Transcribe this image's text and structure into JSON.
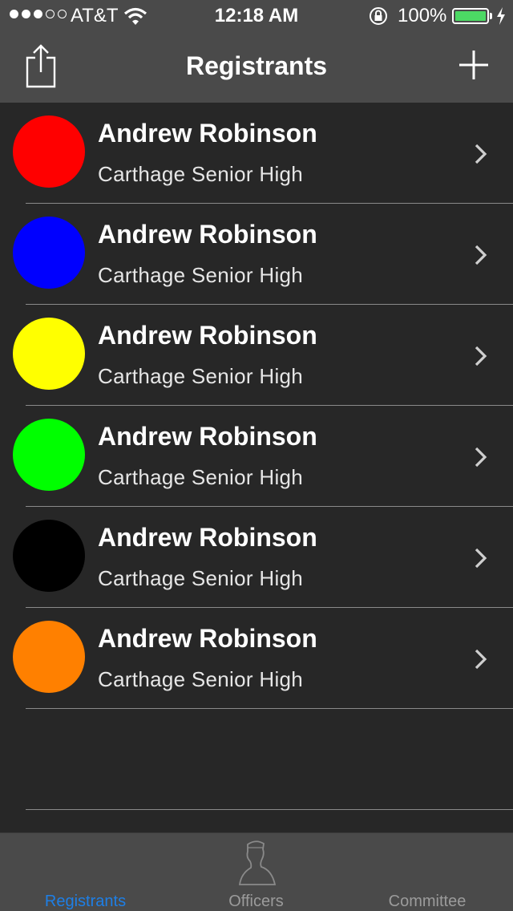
{
  "status_bar": {
    "carrier": "AT&T",
    "time": "12:18 AM",
    "battery_percent": "100%",
    "signal_bars_filled": 3,
    "signal_bars_total": 5
  },
  "nav": {
    "title": "Registrants",
    "left_icon": "share-icon",
    "right_icon": "plus-icon"
  },
  "registrants": [
    {
      "name": "Andrew Robinson",
      "school": "Carthage Senior High",
      "color": "#ff0000"
    },
    {
      "name": "Andrew Robinson",
      "school": "Carthage Senior High",
      "color": "#0000ff"
    },
    {
      "name": "Andrew Robinson",
      "school": "Carthage Senior High",
      "color": "#ffff00"
    },
    {
      "name": "Andrew Robinson",
      "school": "Carthage Senior High",
      "color": "#00ff00"
    },
    {
      "name": "Andrew Robinson",
      "school": "Carthage Senior High",
      "color": "#000000"
    },
    {
      "name": "Andrew Robinson",
      "school": "Carthage Senior High",
      "color": "#ff8000"
    }
  ],
  "tabs": [
    {
      "label": "Registrants",
      "active": true
    },
    {
      "label": "Officers",
      "active": false,
      "icon": "person-silhouette-icon"
    },
    {
      "label": "Committee",
      "active": false
    }
  ],
  "colors": {
    "background": "#272727",
    "bar": "#4a4a4a",
    "accent": "#1e7fe6",
    "battery": "#4cd964"
  }
}
